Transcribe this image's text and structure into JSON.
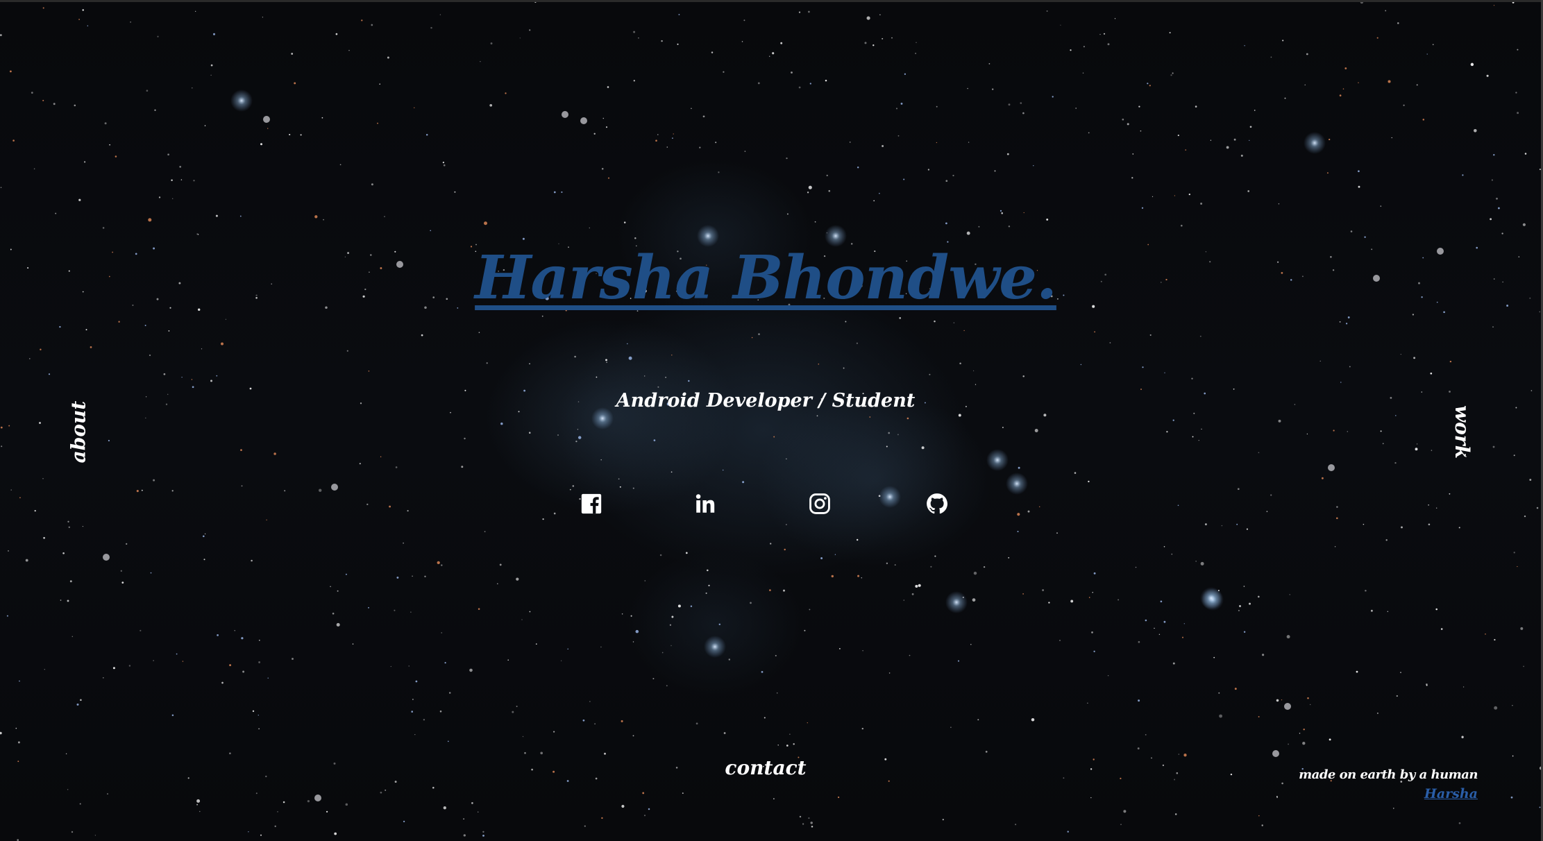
{
  "hero": {
    "title": "Harsha Bhondwe.",
    "subtitle": "Android Developer / Student"
  },
  "nav": {
    "left": "about",
    "right": "work",
    "bottom": "contact"
  },
  "socials": [
    {
      "name": "facebook",
      "icon": "facebook-icon"
    },
    {
      "name": "linkedin",
      "icon": "linkedin-icon"
    },
    {
      "name": "instagram",
      "icon": "instagram-icon"
    },
    {
      "name": "github",
      "icon": "github-icon"
    }
  ],
  "footer": {
    "tagline": "made on earth by a human",
    "author_link": "Harsha"
  },
  "colors": {
    "title": "#1f4e86",
    "text": "#ffffff",
    "link": "#2a5ea8",
    "background": "#08090c"
  }
}
